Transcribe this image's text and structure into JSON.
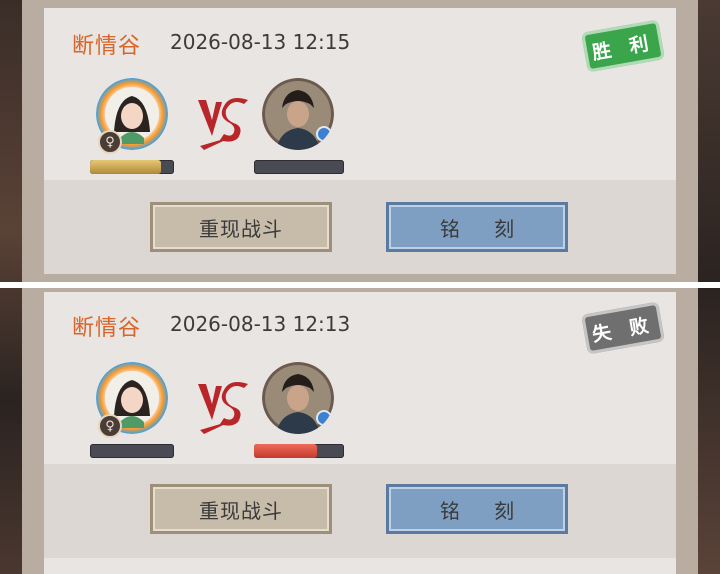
{
  "records": [
    {
      "location": "断情谷",
      "datetime": "2026-08-13 12:15",
      "result_label": "胜 利",
      "result": "win",
      "player": {
        "avatar_icon": "female-hero-avatar",
        "gender_icon": "♀",
        "hp_percent": 85
      },
      "opponent": {
        "avatar_icon": "male-swordsman-avatar",
        "hp_percent": 0
      },
      "buttons": {
        "replay": "重现战斗",
        "engrave": "铭 刻"
      }
    },
    {
      "location": "断情谷",
      "datetime": "2026-08-13 12:13",
      "result_label": "失 败",
      "result": "lose",
      "player": {
        "avatar_icon": "female-hero-avatar",
        "gender_icon": "♀",
        "hp_percent": 0
      },
      "opponent": {
        "avatar_icon": "male-swordsman-avatar",
        "hp_percent": 70
      },
      "buttons": {
        "replay": "重现战斗",
        "engrave": "铭 刻"
      }
    }
  ],
  "colors": {
    "win": "#3aa54a",
    "lose": "#6f6f6f",
    "location": "#d8652a",
    "hp_player": "#c79a45",
    "hp_opponent": "#d94b3d"
  }
}
